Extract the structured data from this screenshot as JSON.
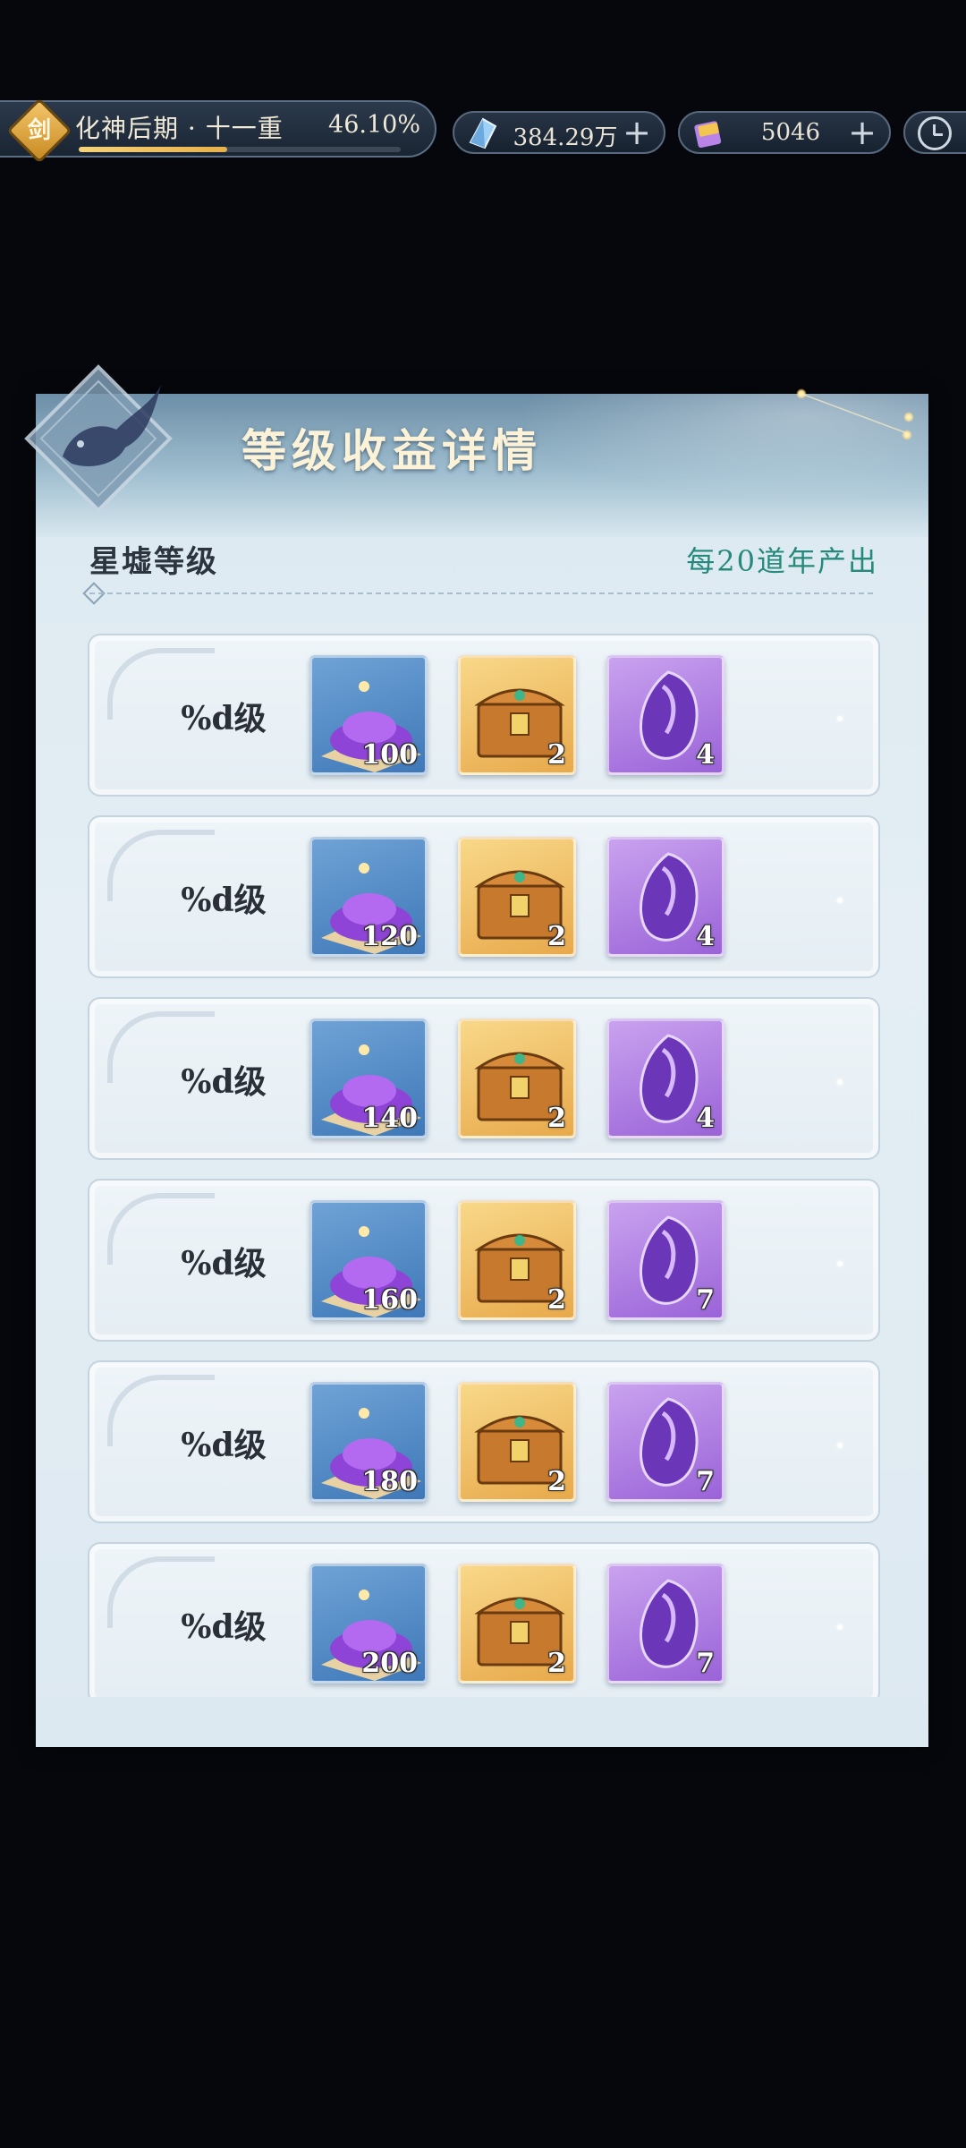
{
  "topbar": {
    "realm_badge": "剑",
    "realm_name": "化神后期 · 十一重",
    "realm_percent": "46.10%",
    "realm_progress": 0.461,
    "crystal": {
      "icon": "crystal-icon",
      "value": "384.29万",
      "plus": "+"
    },
    "ticket": {
      "icon": "ticket-icon",
      "value": "5046",
      "plus": "+"
    },
    "clock": {
      "icon": "clock-icon"
    }
  },
  "panel": {
    "title": "等级收益详情",
    "section_label": "星墟等级",
    "section_rate": "每20道年产出"
  },
  "rows": [
    {
      "label": "%d级",
      "items": [
        "100",
        "2",
        "4"
      ]
    },
    {
      "label": "%d级",
      "items": [
        "120",
        "2",
        "4"
      ]
    },
    {
      "label": "%d级",
      "items": [
        "140",
        "2",
        "4"
      ]
    },
    {
      "label": "%d级",
      "items": [
        "160",
        "2",
        "7"
      ]
    },
    {
      "label": "%d级",
      "items": [
        "180",
        "2",
        "7"
      ]
    },
    {
      "label": "%d级",
      "items": [
        "200",
        "2",
        "7"
      ]
    }
  ],
  "item_icons": [
    "star-dust-pile-icon",
    "treasure-chest-icon",
    "purple-crystal-shard-icon"
  ],
  "colors": {
    "accent_teal": "#25897c",
    "gold": "#f5d27a",
    "panel_bg": "#e4eef4"
  }
}
